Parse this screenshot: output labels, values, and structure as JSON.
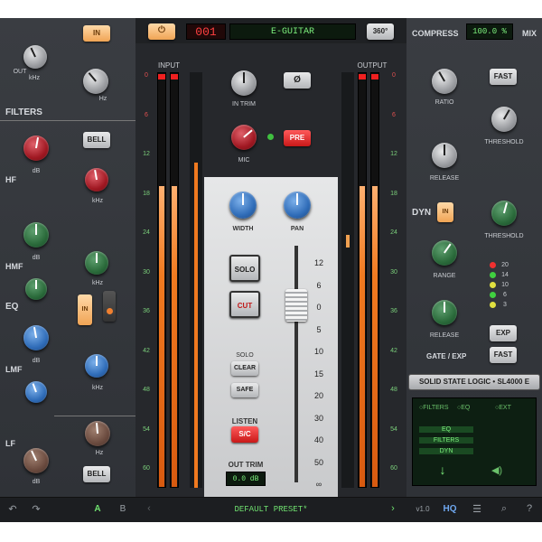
{
  "header": {
    "power_icon": "power-icon",
    "preset_number": "001",
    "preset_name": "E-GUITAR",
    "view_button": "360°"
  },
  "filters": {
    "section_title": "FILTERS",
    "in_button": "IN",
    "lpf": {
      "label": "OUT",
      "unit": "kHz",
      "scale": [
        "5",
        "12",
        "3.5",
        "OUT"
      ]
    },
    "hpf": {
      "unit": "Hz",
      "scale": [
        "70",
        "120",
        "200",
        "20",
        "300",
        "OUT",
        "350"
      ]
    }
  },
  "eq": {
    "section_title": "EQ",
    "in_button": "IN",
    "hf": {
      "label": "HF",
      "bell_button": "BELL",
      "gain_unit": "dB",
      "freq_unit": "kHz"
    },
    "hmf": {
      "label": "HMF",
      "gain_unit": "dB",
      "freq_unit": "kHz"
    },
    "lmf": {
      "label": "LMF",
      "gain_unit": "dB",
      "freq_unit": "kHz"
    },
    "lf": {
      "label": "LF",
      "bell_button": "BELL",
      "gain_unit": "dB",
      "freq_unit": "Hz"
    }
  },
  "input": {
    "label": "INPUT",
    "trim_label": "IN TRIM",
    "mic_label": "MIC",
    "pre_button": "PRE",
    "phase_icon": "Ø",
    "scale": [
      "0",
      "6",
      "12",
      "18",
      "24",
      "30",
      "36",
      "42",
      "48",
      "54",
      "60"
    ],
    "level_left": 0.73,
    "level_right": 0.73
  },
  "center": {
    "width_label": "WIDTH",
    "pan_label": "PAN",
    "solo_button": "SOLO",
    "cut_button": "CUT",
    "solo_section": "SOLO",
    "clear_button": "CLEAR",
    "safe_button": "SAFE",
    "listen_label": "LISTEN",
    "sc_button": "S/C",
    "out_trim_label": "OUT TRIM",
    "out_trim_value": "0.0 dB",
    "fader_scale": [
      "12",
      "6",
      "0",
      "5",
      "10",
      "15",
      "20",
      "30",
      "40",
      "50",
      "∞"
    ]
  },
  "output": {
    "label": "OUTPUT",
    "scale": [
      "0",
      "6",
      "12",
      "18",
      "24",
      "30",
      "36",
      "42",
      "48",
      "54",
      "60"
    ],
    "level_left": 0.73,
    "level_right": 0.73
  },
  "compressor": {
    "title": "COMPRESS",
    "mix_value": "100.0 %",
    "mix_label": "MIX",
    "fast_button": "FAST",
    "ratio_label": "RATIO",
    "threshold_label": "THRESHOLD",
    "release_label": "RELEASE"
  },
  "dyn": {
    "title": "DYN",
    "in_button": "IN",
    "threshold_label": "THRESHOLD",
    "range_label": "RANGE",
    "release_label": "RELEASE",
    "exp_button": "EXP",
    "fast_button": "FAST",
    "section_title": "GATE / EXP",
    "gr_meter": [
      "20",
      "14",
      "10",
      "6",
      "3"
    ]
  },
  "brand": {
    "text": "SOLID STATE LOGIC • SL4000 E"
  },
  "routing": {
    "options": [
      "FILTERS",
      "EQ",
      "EXT"
    ],
    "chain": [
      "EQ",
      "FILTERS",
      "DYN"
    ]
  },
  "footer": {
    "undo_icon": "undo-icon",
    "redo_icon": "redo-icon",
    "a_label": "A",
    "b_label": "B",
    "preset_label": "DEFAULT PRESET*",
    "version": "v1.0",
    "hq_label": "HQ",
    "settings_icon": "sliders-icon",
    "search_icon": "search-icon",
    "help_icon": "help-icon"
  },
  "colors": {
    "accent_orange": "#f0a455",
    "lcd_green": "#7df07d",
    "meter_orange": "#f07a20"
  }
}
